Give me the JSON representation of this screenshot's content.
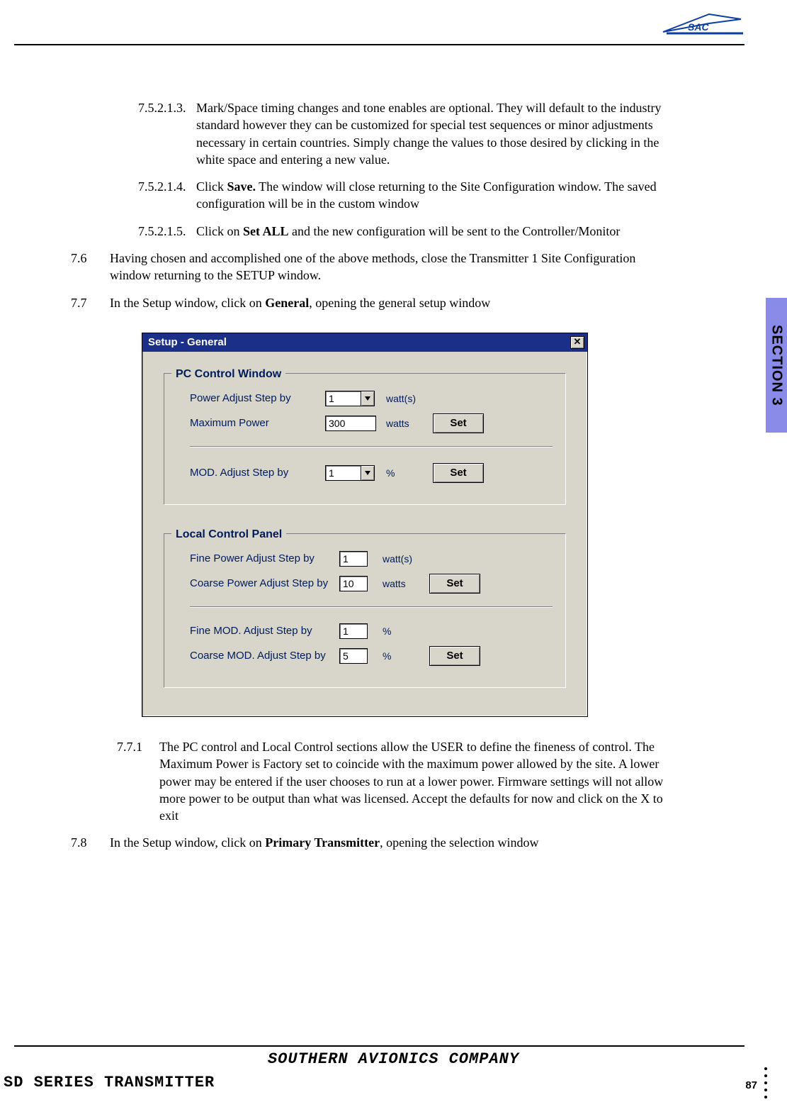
{
  "header": {
    "logo_alt": "SAC"
  },
  "section_tab": "SECTION 3",
  "paragraphs": {
    "p75213_num": "7.5.2.1.3.",
    "p75213": "Mark/Space timing changes and tone enables are optional. They will default to the industry standard however they can be customized for special test sequences or minor adjustments necessary in certain countries. Simply change the values to those desired by clicking in the white space and entering a new value.",
    "p75214_num": "7.5.2.1.4.",
    "p75214_a": "Click ",
    "p75214_b": "Save.",
    "p75214_c": " The window will close returning to the Site Configuration window. The saved configuration will be in the custom window",
    "p75215_num": "7.5.2.1.5.",
    "p75215_a": "Click on ",
    "p75215_b": "Set ALL",
    "p75215_c": " and the new configuration will be sent to the Controller/Monitor",
    "p76_num": "7.6",
    "p76": "Having chosen and accomplished one of the above methods, close the Transmitter 1 Site Configuration window returning to the SETUP window.",
    "p77_num": "7.7",
    "p77_a": "In the Setup window, click on ",
    "p77_b": "General",
    "p77_c": ", opening the general setup window",
    "p771_num": "7.7.1",
    "p771": "The PC control and Local Control sections allow the USER to define the fineness of control. The Maximum Power is Factory set to coincide with the maximum power allowed by the site. A lower power may be entered if the user chooses to run at a lower power. Firmware settings will not allow more power to be output than what was licensed. Accept the defaults for now and click on the X to exit",
    "p78_num": "7.8",
    "p78_a": "In the Setup window, click on ",
    "p78_b": "Primary Transmitter",
    "p78_c": ", opening the selection window"
  },
  "dialog": {
    "title": "Setup - General",
    "close": "✕",
    "groups": {
      "pc": {
        "legend": "PC Control Window",
        "power_label": "Power Adjust Step by",
        "power_value": "1",
        "power_unit": "watt(s)",
        "maxpow_label": "Maximum Power",
        "maxpow_value": "300",
        "maxpow_unit": "watts",
        "set1": "Set",
        "mod_label": "MOD. Adjust Step by",
        "mod_value": "1",
        "mod_unit": "%",
        "set2": "Set"
      },
      "local": {
        "legend": "Local Control Panel",
        "fine_pow_label": "Fine Power Adjust Step by",
        "fine_pow_value": "1",
        "fine_pow_unit": "watt(s)",
        "coarse_pow_label": "Coarse Power Adjust Step by",
        "coarse_pow_value": "10",
        "coarse_pow_unit": "watts",
        "set3": "Set",
        "fine_mod_label": "Fine MOD. Adjust Step by",
        "fine_mod_value": "1",
        "fine_mod_unit": "%",
        "coarse_mod_label": "Coarse MOD. Adjust Step by",
        "coarse_mod_value": "5",
        "coarse_mod_unit": "%",
        "set4": "Set"
      }
    }
  },
  "footer": {
    "company": "SOUTHERN AVIONICS COMPANY",
    "series": "SD SERIES TRANSMITTER",
    "page": "87"
  }
}
